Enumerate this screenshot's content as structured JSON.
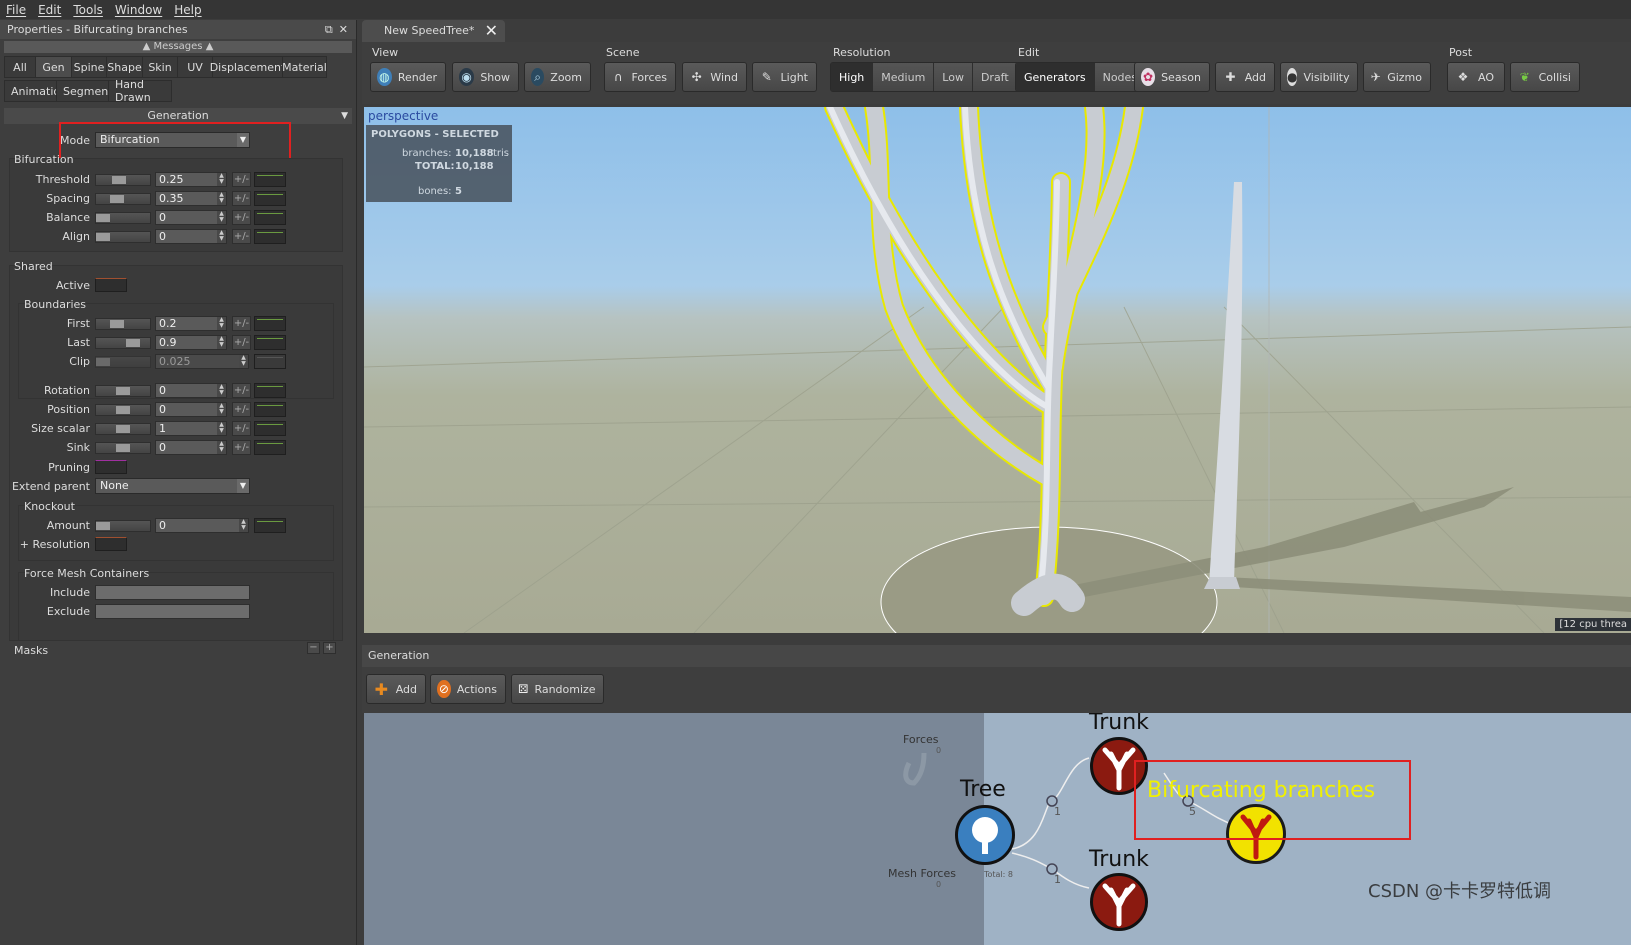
{
  "menu": [
    "File",
    "Edit",
    "Tools",
    "Window",
    "Help"
  ],
  "left_panel": {
    "title": "Properties - Bifurcating branches",
    "messages_label": "Messages",
    "tabs_row1": [
      "All",
      "Gen",
      "Spine",
      "Shape",
      "Skin",
      "UV",
      "Displacement",
      "Material"
    ],
    "tabs_row2": [
      "Animation",
      "Segments",
      "Hand Drawn"
    ],
    "active_tab": "Gen",
    "generation_header": "Generation",
    "mode_label": "Mode",
    "mode_value": "Bifurcation",
    "bifurcation_group": "Bifurcation",
    "bifurcation": [
      {
        "label": "Threshold",
        "value": "0.25"
      },
      {
        "label": "Spacing",
        "value": "0.35"
      },
      {
        "label": "Balance",
        "value": "0"
      },
      {
        "label": "Align",
        "value": "0"
      }
    ],
    "shared_group": "Shared",
    "active_label": "Active",
    "boundaries_group": "Boundaries",
    "boundaries": [
      {
        "label": "First",
        "value": "0.2"
      },
      {
        "label": "Last",
        "value": "0.9"
      },
      {
        "label": "Clip",
        "value": "0.025"
      }
    ],
    "transform": [
      {
        "label": "Rotation",
        "value": "0"
      },
      {
        "label": "Position",
        "value": "0"
      },
      {
        "label": "Size scalar",
        "value": "1"
      },
      {
        "label": "Sink",
        "value": "0"
      }
    ],
    "pruning_label": "Pruning",
    "extend_parent_label": "Extend parent",
    "extend_parent_value": "None",
    "knockout_group": "Knockout",
    "amount_label": "Amount",
    "amount_value": "0",
    "resolution_label": "+ Resolution",
    "force_mesh_group": "Force Mesh Containers",
    "include_label": "Include",
    "exclude_label": "Exclude",
    "masks_label": "Masks",
    "pm_label": "+/-"
  },
  "document_tab": "New SpeedTree*",
  "toolbar": {
    "view": {
      "label": "View",
      "buttons": [
        "Render",
        "Show",
        "Zoom"
      ]
    },
    "scene": {
      "label": "Scene",
      "buttons": [
        "Forces",
        "Wind",
        "Light"
      ]
    },
    "resolution": {
      "label": "Resolution",
      "options": [
        "High",
        "Medium",
        "Low",
        "Draft"
      ],
      "selected": "High"
    },
    "edit": {
      "label": "Edit",
      "segment": [
        "Generators",
        "Nodes"
      ],
      "selected": "Generators",
      "buttons": [
        "Season",
        "Add",
        "Visibility",
        "Gizmo"
      ]
    },
    "post": {
      "label": "Post",
      "buttons": [
        "AO",
        "Collisi"
      ]
    }
  },
  "viewport": {
    "label": "perspective",
    "stats_title": "POLYGONS - SELECTED",
    "branches_label": "branches:",
    "branches_value": "10,188",
    "branches_unit": "tris",
    "total_label": "TOTAL:",
    "total_value": "10,188",
    "bones_label": "bones:",
    "bones_value": "5",
    "cpu_label": "[12 cpu threa"
  },
  "generation_panel": {
    "header": "Generation",
    "buttons": [
      "Add",
      "Actions",
      "Randomize"
    ]
  },
  "graph": {
    "forces_label": "Forces",
    "forces_count": "0",
    "mesh_forces_label": "Mesh Forces",
    "mesh_forces_count": "0",
    "tree_label": "Tree",
    "tree_total": "Total: 8",
    "trunk_top_label": "Trunk",
    "trunk_bottom_label": "Trunk",
    "edge_top_count": "1",
    "edge_bottom_count": "1",
    "bifurcating_label": "Bifurcating branches",
    "bifurcating_count": "5"
  },
  "watermark": "CSDN @卡卡罗特低调",
  "colors": {
    "highlight_red": "#e02020",
    "selection_yellow": "#f0f000",
    "node_red": "#8b1a10",
    "node_yellow": "#f2e200",
    "node_blue": "#3a7fbf"
  }
}
